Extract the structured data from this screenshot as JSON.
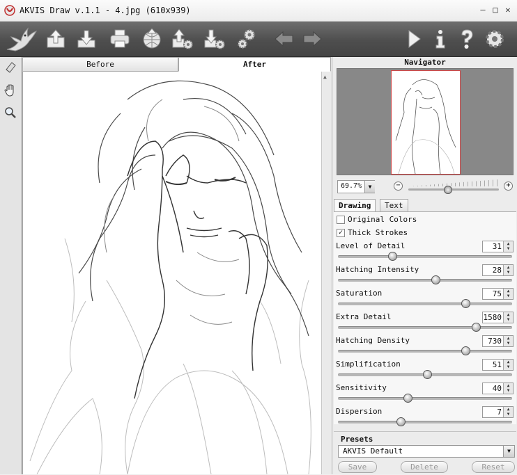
{
  "window": {
    "title": "AKVIS Draw v.1.1 - 4.jpg (610x939)",
    "minimize": "—",
    "maximize": "□",
    "close": "✕"
  },
  "toolbar": {
    "icons": [
      "bird-logo-icon",
      "open-image-icon",
      "save-image-icon",
      "print-icon",
      "share-icon",
      "load-settings-icon",
      "save-settings-icon",
      "preferences-icon",
      "undo-arrow-icon",
      "redo-arrow-icon",
      "run-icon",
      "info-icon",
      "help-icon",
      "settings-gear-icon"
    ]
  },
  "tools": [
    "eraser-icon",
    "hand-icon",
    "zoom-icon"
  ],
  "view_tabs": {
    "before": "Before",
    "after": "After",
    "active": "After"
  },
  "navigator": {
    "title": "Navigator",
    "zoom": "69.7%",
    "zoom_level": 0.44
  },
  "settings_tabs": {
    "drawing": "Drawing",
    "text": "Text",
    "active": "Drawing"
  },
  "options": {
    "original_colors": {
      "label": "Original Colors",
      "checked": false
    },
    "thick_strokes": {
      "label": "Thick Strokes",
      "checked": true
    }
  },
  "parameters": [
    {
      "label": "Level of Detail",
      "value": "31",
      "level": 0.31
    },
    {
      "label": "Hatching Intensity",
      "value": "28",
      "level": 0.56
    },
    {
      "label": "Saturation",
      "value": "75",
      "level": 0.73
    },
    {
      "label": "Extra Detail",
      "value": "1580",
      "level": 0.79
    },
    {
      "label": "Hatching Density",
      "value": "730",
      "level": 0.73
    },
    {
      "label": "Simplification",
      "value": "51",
      "level": 0.51
    },
    {
      "label": "Sensitivity",
      "value": "40",
      "level": 0.4
    },
    {
      "label": "Dispersion",
      "value": "7",
      "level": 0.36
    }
  ],
  "presets": {
    "title": "Presets",
    "selected": "AKVIS Default",
    "save": "Save",
    "delete": "Delete",
    "reset": "Reset"
  },
  "colors": {
    "toolbar": "#555555",
    "nav_frame": "#d04848",
    "panel": "#ececec"
  }
}
